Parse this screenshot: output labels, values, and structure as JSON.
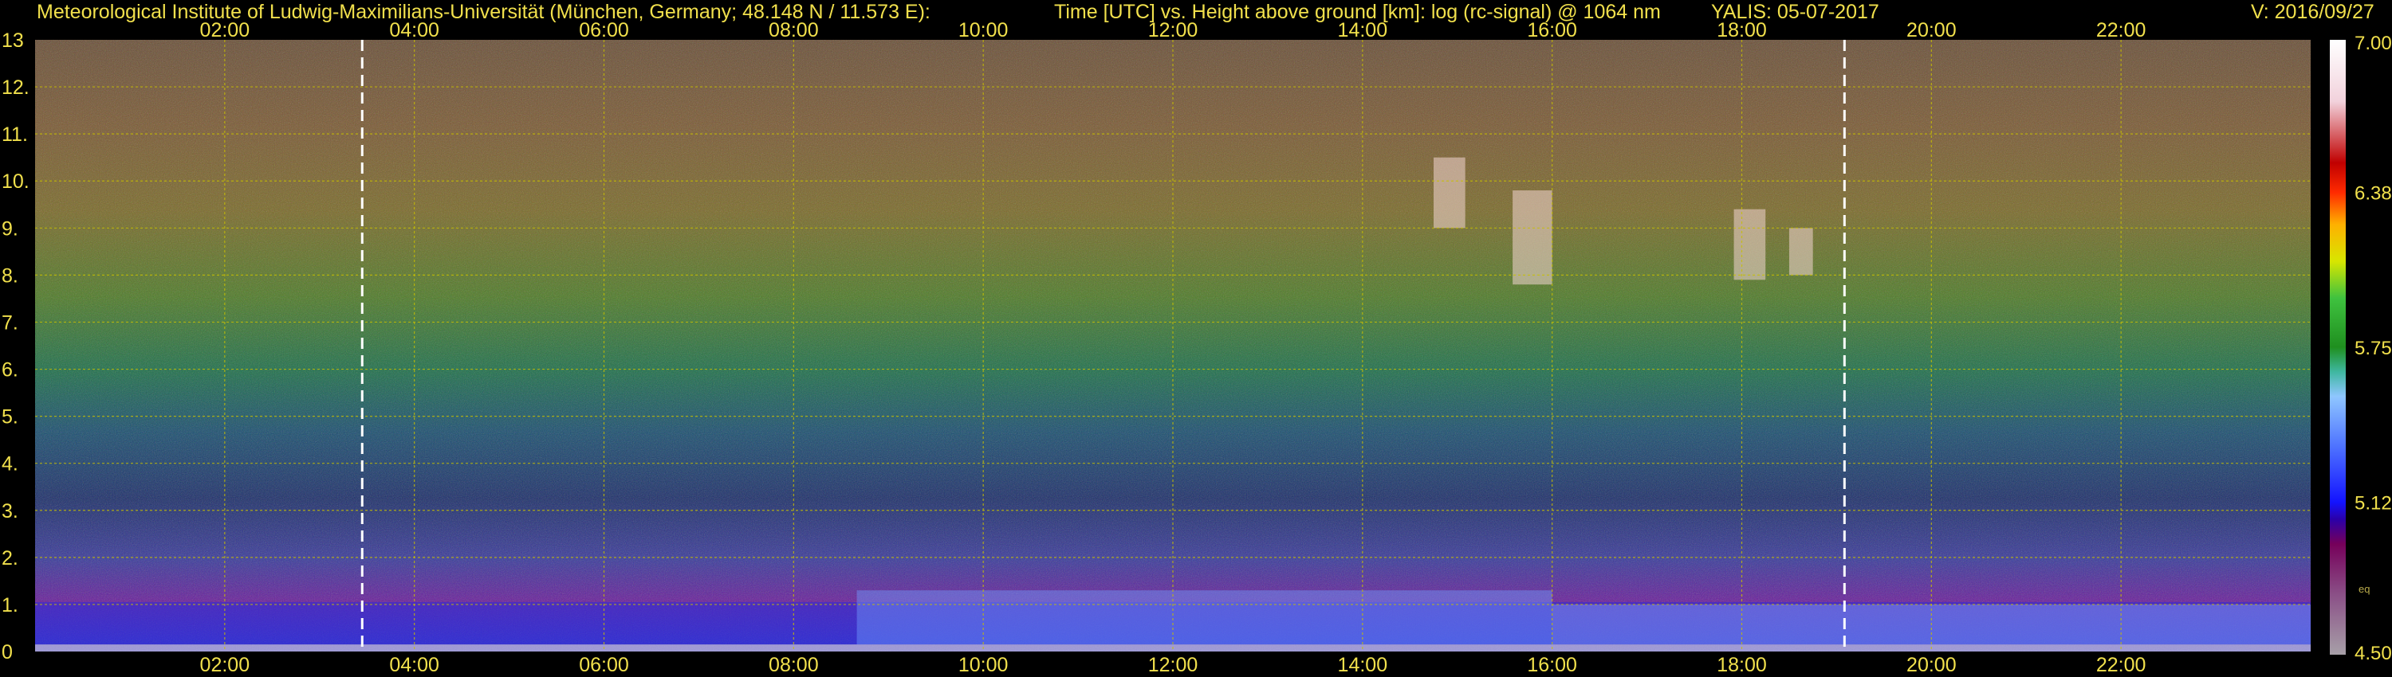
{
  "header": {
    "institute": "Meteorological Institute of Ludwig-Maximilians-Universität (München, Germany; 48.148 N / 11.573 E):",
    "title": "Time [UTC] vs. Height above ground [km]: log (rc-signal) @ 1064 nm",
    "station": "YALIS: 05-07-2017",
    "version": "V: 2016/09/27"
  },
  "colors": {
    "background": "#000000",
    "text": "#f1e04c",
    "grid": "#c8c000",
    "marker": "#ffffff"
  },
  "chart_data": {
    "type": "heatmap",
    "title": "Time [UTC] vs. Height above ground [km]: log (rc-signal) @ 1064 nm",
    "xlim": [
      "00:00",
      "24:00"
    ],
    "x_ticks": [
      "02:00",
      "04:00",
      "06:00",
      "08:00",
      "10:00",
      "12:00",
      "14:00",
      "16:00",
      "18:00",
      "20:00",
      "22:00"
    ],
    "ylim": [
      0,
      13
    ],
    "y_ticks": [
      "0",
      "1.",
      "2.",
      "3.",
      "4.",
      "5.",
      "6.",
      "7.",
      "8.",
      "9.",
      "10.",
      "11.",
      "12.",
      "13"
    ],
    "grid": true,
    "markers_utc": [
      "03:27",
      "19:05"
    ],
    "colorbar": {
      "range": [
        4.5,
        7.0
      ],
      "tick_labels": [
        "7.00",
        "6.38",
        "5.75",
        "5.12",
        "4.50"
      ],
      "tick_values": [
        7.0,
        6.38,
        5.75,
        5.12,
        4.5
      ],
      "note": "eq",
      "stops": [
        {
          "v": 4.5,
          "c": "#a7a0a8"
        },
        {
          "v": 4.75,
          "c": "#8a4e86"
        },
        {
          "v": 4.95,
          "c": "#76005a"
        },
        {
          "v": 5.05,
          "c": "#2b00a8"
        },
        {
          "v": 5.12,
          "c": "#1313ff"
        },
        {
          "v": 5.35,
          "c": "#4f74ff"
        },
        {
          "v": 5.55,
          "c": "#8fc6ff"
        },
        {
          "v": 5.65,
          "c": "#3fb7a0"
        },
        {
          "v": 5.75,
          "c": "#1f8f1f"
        },
        {
          "v": 5.95,
          "c": "#3fc23f"
        },
        {
          "v": 6.1,
          "c": "#d8e600"
        },
        {
          "v": 6.25,
          "c": "#ffb000"
        },
        {
          "v": 6.38,
          "c": "#ff2a00"
        },
        {
          "v": 6.5,
          "c": "#c00000"
        },
        {
          "v": 6.75,
          "c": "#f2d2dc"
        },
        {
          "v": 7.0,
          "c": "#ffffff"
        }
      ]
    }
  }
}
